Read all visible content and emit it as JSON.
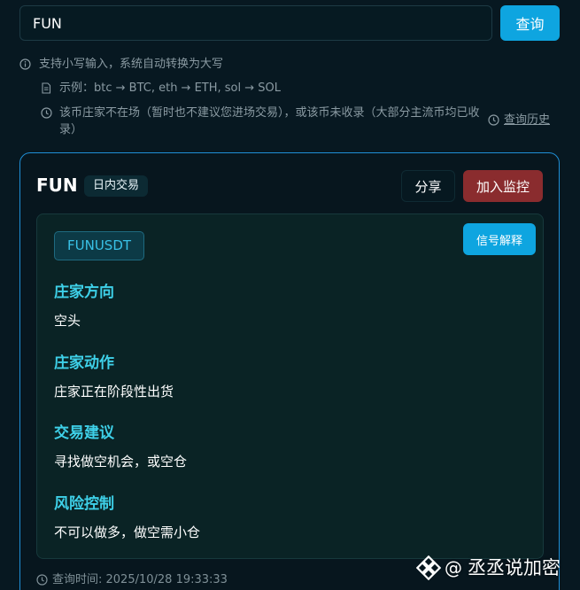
{
  "search": {
    "value": "FUN",
    "button_label": "查询"
  },
  "hints": {
    "lowercase": "支持小写输入，系统自动转换为大写",
    "example": "示例：btc → BTC, eth → ETH, sol → SOL",
    "not_listed": "该币庄家不在场（暂时也不建议您进场交易），或该币未收录（大部分主流币均已收录）",
    "history_label": "查询历史"
  },
  "card": {
    "symbol": "FUN",
    "mode_badge": "日内交易",
    "share_label": "分享",
    "monitor_label": "加入监控",
    "pair": "FUNUSDT",
    "explain_label": "信号解释",
    "sections": [
      {
        "title": "庄家方向",
        "value": "空头"
      },
      {
        "title": "庄家动作",
        "value": "庄家正在阶段性出货"
      },
      {
        "title": "交易建议",
        "value": "寻找做空机会，或空仓"
      },
      {
        "title": "风险控制",
        "value": "不可以做多，做空需小仓"
      }
    ],
    "query_time": "查询时间: 2025/10/28 19:33:33"
  },
  "watermark": {
    "at": "@",
    "name": "丞丞说加密"
  },
  "colors": {
    "accent": "#0ea5e0",
    "danger": "#8a2c2e",
    "section_title": "#3ed0e8",
    "background": "#071821"
  }
}
